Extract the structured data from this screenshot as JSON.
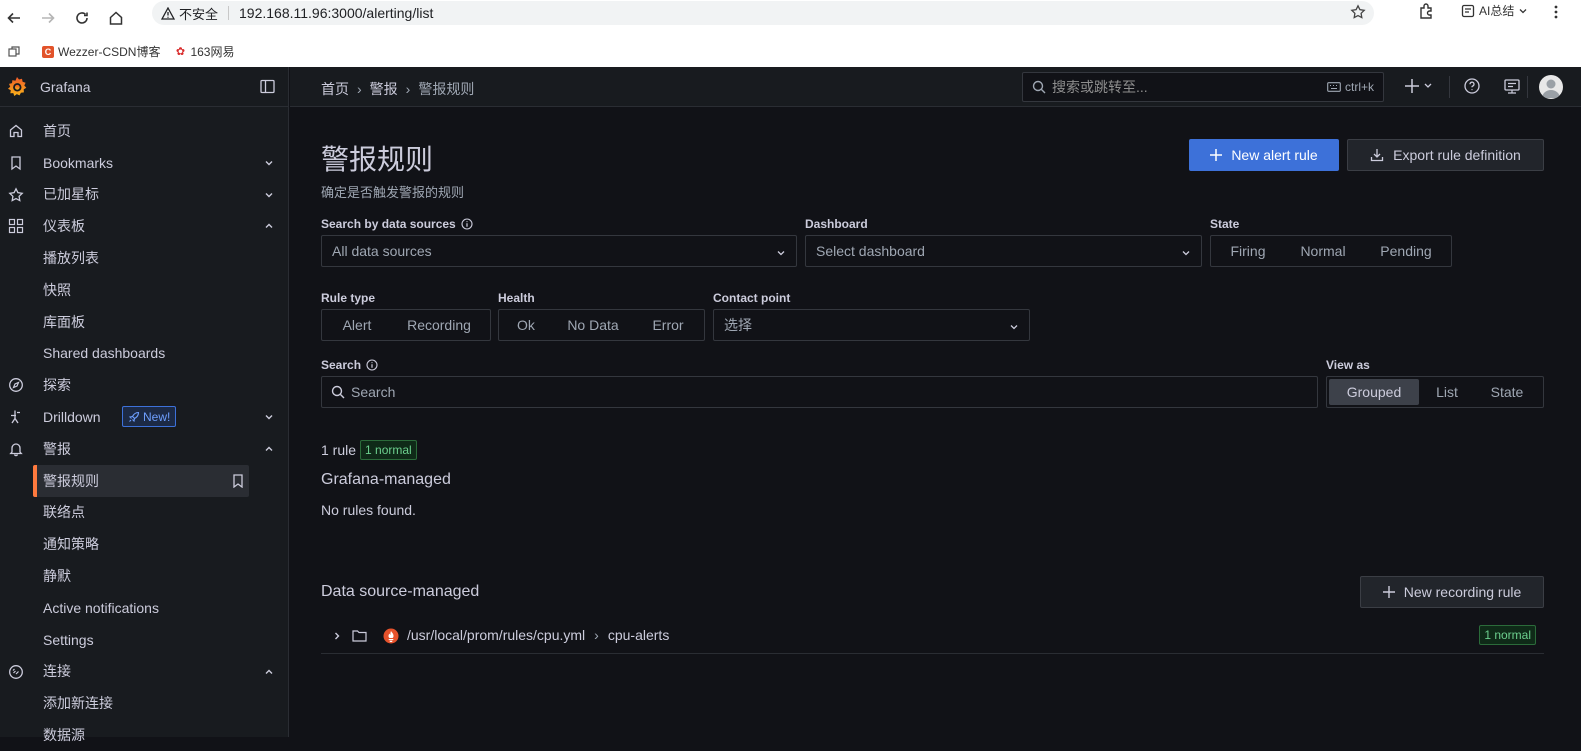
{
  "browser": {
    "security_label": "不安全",
    "url": "192.168.11.96:3000/alerting/list",
    "ai_label": "AI总结",
    "bookmarks": [
      {
        "label": "Wezzer-CSDN博客",
        "icon": "csdn-icon",
        "color": "#e2532a"
      },
      {
        "label": "163网易",
        "icon": "netease-icon",
        "color": "#d92b2b"
      }
    ]
  },
  "brand": {
    "name": "Grafana",
    "accent": "#ff7a3e"
  },
  "sidebar": {
    "items": [
      {
        "label": "首页",
        "icon": "home-icon"
      },
      {
        "label": "Bookmarks",
        "icon": "bookmark-icon",
        "chevron": "down"
      },
      {
        "label": "已加星标",
        "icon": "star-icon",
        "chevron": "down"
      },
      {
        "label": "仪表板",
        "icon": "apps-icon",
        "chevron": "up"
      },
      {
        "label": "播放列表",
        "sub": true
      },
      {
        "label": "快照",
        "sub": true
      },
      {
        "label": "库面板",
        "sub": true
      },
      {
        "label": "Shared dashboards",
        "sub": true
      },
      {
        "label": "探索",
        "icon": "compass-icon"
      },
      {
        "label": "Drilldown",
        "icon": "drilldown-icon",
        "chevron": "down",
        "badge": "New!"
      },
      {
        "label": "警报",
        "icon": "bell-icon",
        "chevron": "up"
      },
      {
        "label": "警报规则",
        "sub": true,
        "active": true
      },
      {
        "label": "联络点",
        "sub": true
      },
      {
        "label": "通知策略",
        "sub": true
      },
      {
        "label": "静默",
        "sub": true
      },
      {
        "label": "Active notifications",
        "sub": true
      },
      {
        "label": "Settings",
        "sub": true
      },
      {
        "label": "连接",
        "icon": "link-icon",
        "chevron": "up"
      },
      {
        "label": "添加新连接",
        "sub": true
      },
      {
        "label": "数据源",
        "sub": true
      }
    ]
  },
  "topbar": {
    "breadcrumbs": [
      "首页",
      "警报",
      "警报规则"
    ],
    "search_placeholder": "搜索或跳转至...",
    "shortcut": "ctrl+k"
  },
  "page": {
    "title": "警报规则",
    "subtitle": "确定是否触发警报的规则",
    "new_alert_rule": "New alert rule",
    "export_rule": "Export rule definition"
  },
  "filters": {
    "datasource_label": "Search by data sources",
    "datasource_value": "All data sources",
    "dashboard_label": "Dashboard",
    "dashboard_placeholder": "Select dashboard",
    "state_label": "State",
    "state_options": [
      "Firing",
      "Normal",
      "Pending"
    ],
    "rule_type_label": "Rule type",
    "rule_type_options": [
      "Alert",
      "Recording"
    ],
    "health_label": "Health",
    "health_options": [
      "Ok",
      "No Data",
      "Error"
    ],
    "contact_label": "Contact point",
    "contact_placeholder": "选择",
    "search_label": "Search",
    "search_placeholder": "Search",
    "view_as_label": "View as",
    "view_as_options": [
      "Grouped",
      "List",
      "State"
    ],
    "view_as_selected": "Grouped"
  },
  "results": {
    "count": "1 rule",
    "count_badge": "1 normal",
    "grafana_managed": "Grafana-managed",
    "no_rules": "No rules found.",
    "ds_managed": "Data source-managed",
    "new_recording_rule": "New recording rule",
    "row": {
      "namespace": "/usr/local/prom/rules/cpu.yml",
      "group": "cpu-alerts",
      "badge": "1 normal",
      "source_icon": "prometheus-icon"
    }
  }
}
